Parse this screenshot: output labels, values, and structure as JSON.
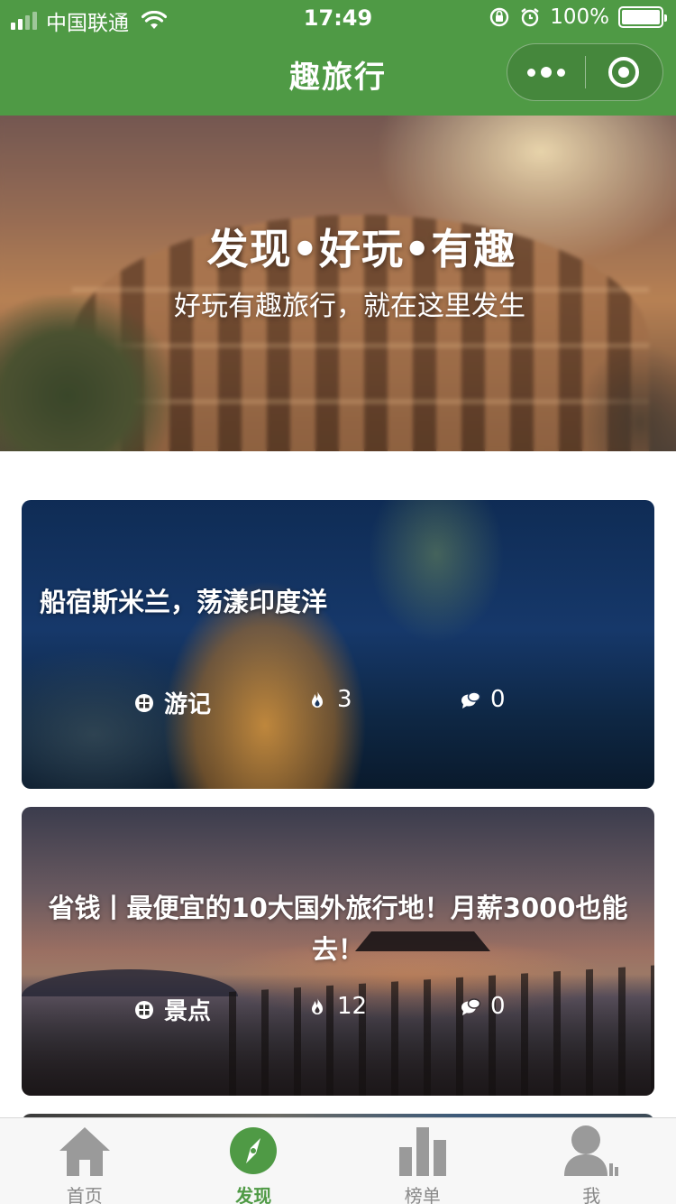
{
  "status_bar": {
    "carrier": "中国联通",
    "time": "17:49",
    "battery": "100%",
    "icons": [
      "signal-icon",
      "wifi-icon",
      "orientation-lock-icon",
      "alarm-icon",
      "battery-icon"
    ]
  },
  "nav": {
    "title": "趣旅行",
    "capsule_icons": [
      "more-icon",
      "close-miniprogram-icon"
    ]
  },
  "hero": {
    "title": "发现•好玩•有趣",
    "subtitle": "好玩有趣旅行，就在这里发生"
  },
  "cards": [
    {
      "title": "船宿斯米兰，荡漾印度洋",
      "category": "游记",
      "hot": "3",
      "comments": "0"
    },
    {
      "title": "省钱丨最便宜的10大国外旅行地！月薪3000也能去！",
      "category": "景点",
      "hot": "12",
      "comments": "0"
    }
  ],
  "tabbar": {
    "items": [
      {
        "label": "首页",
        "icon": "home-icon",
        "active": false
      },
      {
        "label": "发现",
        "icon": "compass-icon",
        "active": true
      },
      {
        "label": "榜单",
        "icon": "bar-chart-icon",
        "active": false
      },
      {
        "label": "我",
        "icon": "user-icon",
        "active": false
      }
    ],
    "active_color": "#4f9a45",
    "inactive_color": "#9a9a9a"
  },
  "colors": {
    "brand_green": "#4f9a45",
    "background": "#ffffff"
  }
}
